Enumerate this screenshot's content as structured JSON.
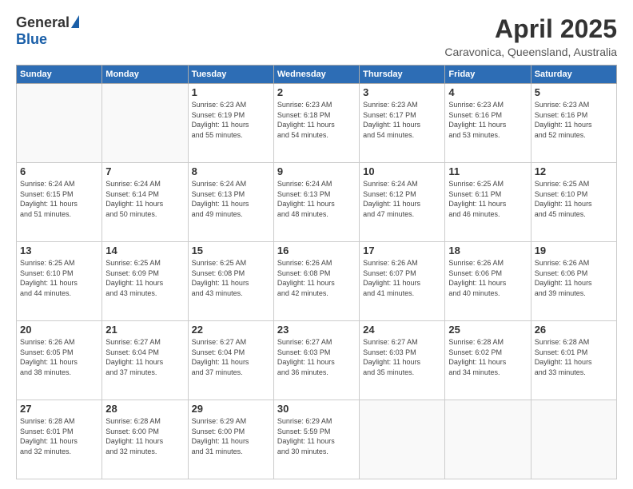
{
  "header": {
    "logo_general": "General",
    "logo_blue": "Blue",
    "title": "April 2025",
    "location": "Caravonica, Queensland, Australia"
  },
  "weekdays": [
    "Sunday",
    "Monday",
    "Tuesday",
    "Wednesday",
    "Thursday",
    "Friday",
    "Saturday"
  ],
  "weeks": [
    [
      {
        "day": "",
        "info": ""
      },
      {
        "day": "",
        "info": ""
      },
      {
        "day": "1",
        "info": "Sunrise: 6:23 AM\nSunset: 6:19 PM\nDaylight: 11 hours\nand 55 minutes."
      },
      {
        "day": "2",
        "info": "Sunrise: 6:23 AM\nSunset: 6:18 PM\nDaylight: 11 hours\nand 54 minutes."
      },
      {
        "day": "3",
        "info": "Sunrise: 6:23 AM\nSunset: 6:17 PM\nDaylight: 11 hours\nand 54 minutes."
      },
      {
        "day": "4",
        "info": "Sunrise: 6:23 AM\nSunset: 6:16 PM\nDaylight: 11 hours\nand 53 minutes."
      },
      {
        "day": "5",
        "info": "Sunrise: 6:23 AM\nSunset: 6:16 PM\nDaylight: 11 hours\nand 52 minutes."
      }
    ],
    [
      {
        "day": "6",
        "info": "Sunrise: 6:24 AM\nSunset: 6:15 PM\nDaylight: 11 hours\nand 51 minutes."
      },
      {
        "day": "7",
        "info": "Sunrise: 6:24 AM\nSunset: 6:14 PM\nDaylight: 11 hours\nand 50 minutes."
      },
      {
        "day": "8",
        "info": "Sunrise: 6:24 AM\nSunset: 6:13 PM\nDaylight: 11 hours\nand 49 minutes."
      },
      {
        "day": "9",
        "info": "Sunrise: 6:24 AM\nSunset: 6:13 PM\nDaylight: 11 hours\nand 48 minutes."
      },
      {
        "day": "10",
        "info": "Sunrise: 6:24 AM\nSunset: 6:12 PM\nDaylight: 11 hours\nand 47 minutes."
      },
      {
        "day": "11",
        "info": "Sunrise: 6:25 AM\nSunset: 6:11 PM\nDaylight: 11 hours\nand 46 minutes."
      },
      {
        "day": "12",
        "info": "Sunrise: 6:25 AM\nSunset: 6:10 PM\nDaylight: 11 hours\nand 45 minutes."
      }
    ],
    [
      {
        "day": "13",
        "info": "Sunrise: 6:25 AM\nSunset: 6:10 PM\nDaylight: 11 hours\nand 44 minutes."
      },
      {
        "day": "14",
        "info": "Sunrise: 6:25 AM\nSunset: 6:09 PM\nDaylight: 11 hours\nand 43 minutes."
      },
      {
        "day": "15",
        "info": "Sunrise: 6:25 AM\nSunset: 6:08 PM\nDaylight: 11 hours\nand 43 minutes."
      },
      {
        "day": "16",
        "info": "Sunrise: 6:26 AM\nSunset: 6:08 PM\nDaylight: 11 hours\nand 42 minutes."
      },
      {
        "day": "17",
        "info": "Sunrise: 6:26 AM\nSunset: 6:07 PM\nDaylight: 11 hours\nand 41 minutes."
      },
      {
        "day": "18",
        "info": "Sunrise: 6:26 AM\nSunset: 6:06 PM\nDaylight: 11 hours\nand 40 minutes."
      },
      {
        "day": "19",
        "info": "Sunrise: 6:26 AM\nSunset: 6:06 PM\nDaylight: 11 hours\nand 39 minutes."
      }
    ],
    [
      {
        "day": "20",
        "info": "Sunrise: 6:26 AM\nSunset: 6:05 PM\nDaylight: 11 hours\nand 38 minutes."
      },
      {
        "day": "21",
        "info": "Sunrise: 6:27 AM\nSunset: 6:04 PM\nDaylight: 11 hours\nand 37 minutes."
      },
      {
        "day": "22",
        "info": "Sunrise: 6:27 AM\nSunset: 6:04 PM\nDaylight: 11 hours\nand 37 minutes."
      },
      {
        "day": "23",
        "info": "Sunrise: 6:27 AM\nSunset: 6:03 PM\nDaylight: 11 hours\nand 36 minutes."
      },
      {
        "day": "24",
        "info": "Sunrise: 6:27 AM\nSunset: 6:03 PM\nDaylight: 11 hours\nand 35 minutes."
      },
      {
        "day": "25",
        "info": "Sunrise: 6:28 AM\nSunset: 6:02 PM\nDaylight: 11 hours\nand 34 minutes."
      },
      {
        "day": "26",
        "info": "Sunrise: 6:28 AM\nSunset: 6:01 PM\nDaylight: 11 hours\nand 33 minutes."
      }
    ],
    [
      {
        "day": "27",
        "info": "Sunrise: 6:28 AM\nSunset: 6:01 PM\nDaylight: 11 hours\nand 32 minutes."
      },
      {
        "day": "28",
        "info": "Sunrise: 6:28 AM\nSunset: 6:00 PM\nDaylight: 11 hours\nand 32 minutes."
      },
      {
        "day": "29",
        "info": "Sunrise: 6:29 AM\nSunset: 6:00 PM\nDaylight: 11 hours\nand 31 minutes."
      },
      {
        "day": "30",
        "info": "Sunrise: 6:29 AM\nSunset: 5:59 PM\nDaylight: 11 hours\nand 30 minutes."
      },
      {
        "day": "",
        "info": ""
      },
      {
        "day": "",
        "info": ""
      },
      {
        "day": "",
        "info": ""
      }
    ]
  ]
}
